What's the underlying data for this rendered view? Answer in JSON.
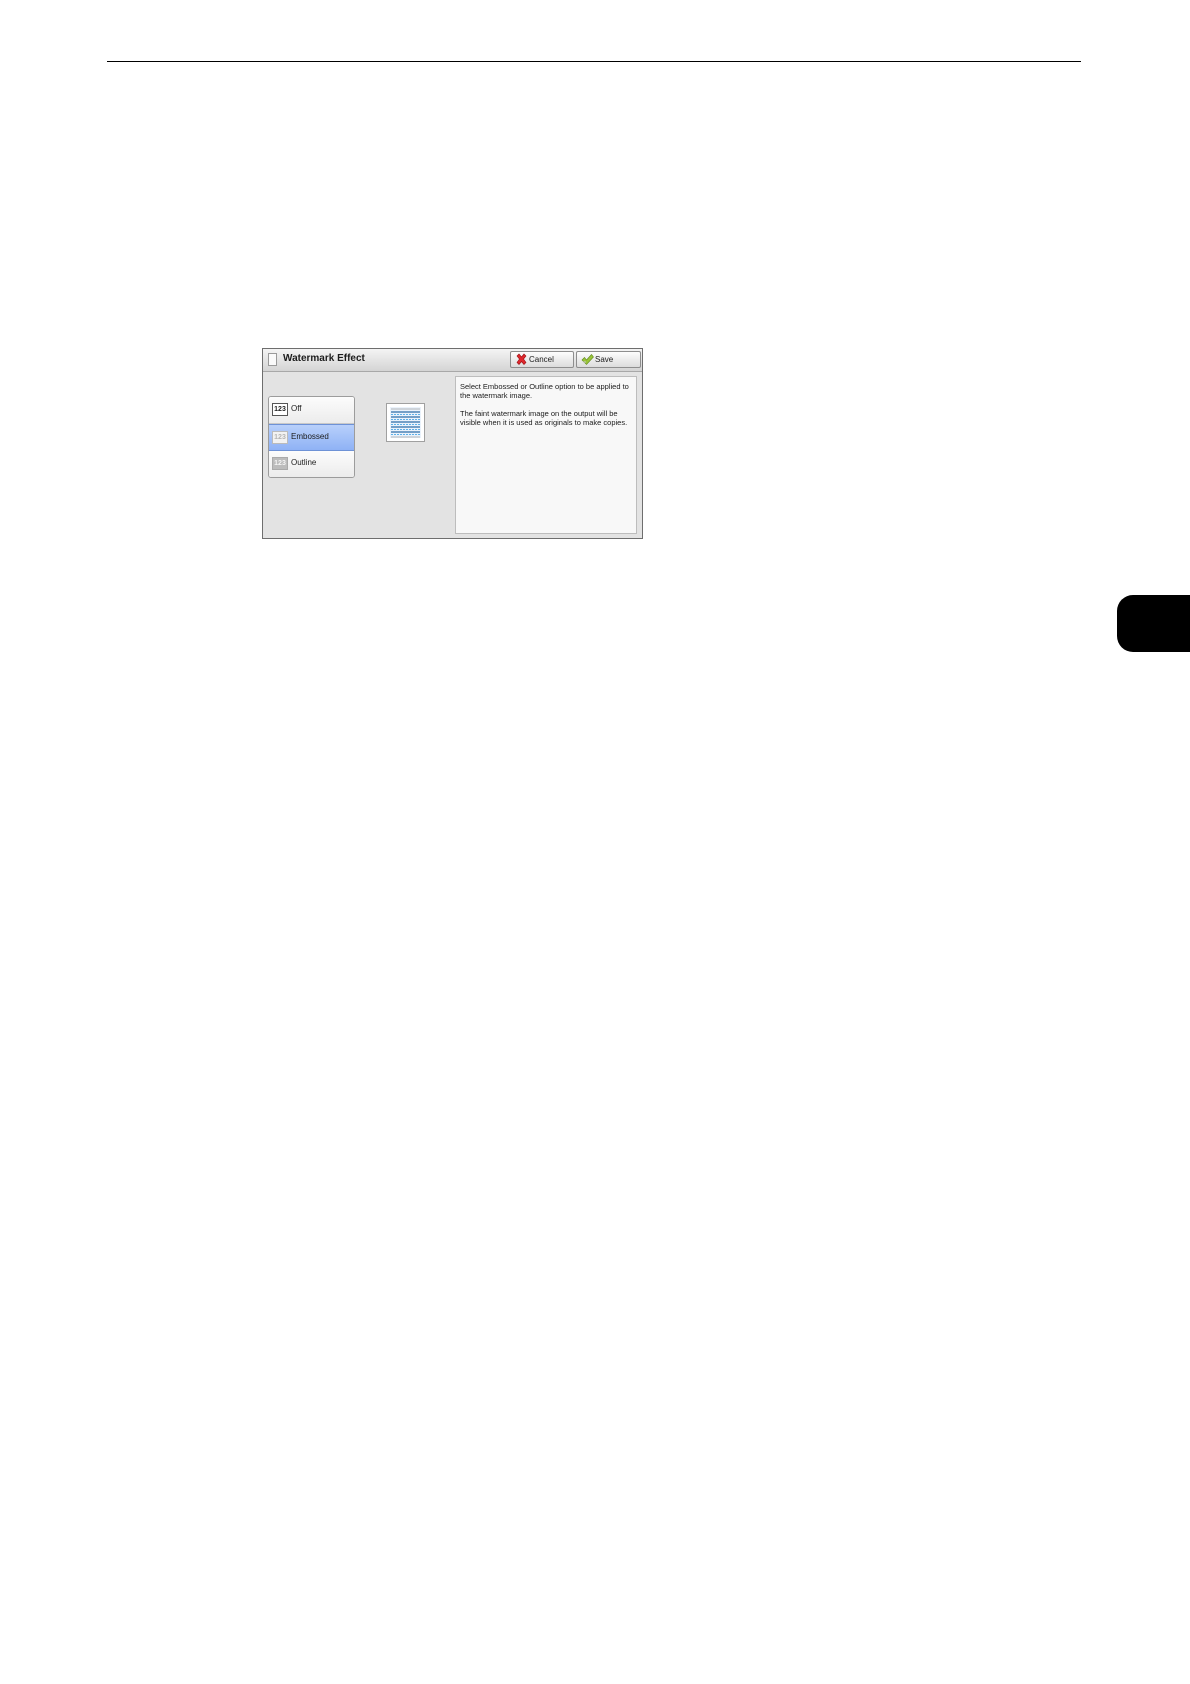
{
  "dialog": {
    "title": "Watermark Effect",
    "cancel_label": "Cancel",
    "save_label": "Save",
    "options": [
      {
        "label": "Off",
        "icon_text": "123",
        "selected": false
      },
      {
        "label": "Embossed",
        "icon_text": "123",
        "selected": true
      },
      {
        "label": "Outline",
        "icon_text": "123",
        "selected": false
      }
    ],
    "description": [
      "Select Embossed or Outline option to be applied to the watermark image.",
      "The faint watermark image on the output will be visible when it is used as originals to make copies."
    ],
    "preview_icon": "watermark-preview-icon",
    "cancel_icon": "red-x-icon",
    "save_icon": "green-check-icon",
    "selected_color": "#9bbaf7"
  }
}
